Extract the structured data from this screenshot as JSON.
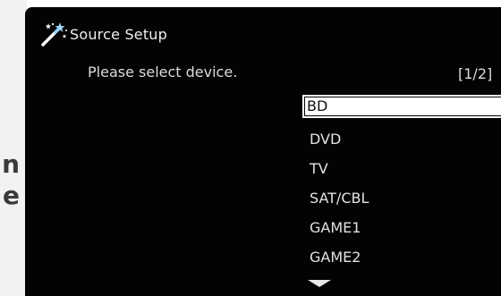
{
  "side_text": [
    "n",
    "e"
  ],
  "header": {
    "icon": "magic-wand-icon",
    "title": "Source Setup"
  },
  "prompt": "Please select device.",
  "page_indicator": "[1/2]",
  "devices": [
    {
      "label": "BD",
      "selected": true
    },
    {
      "label": "DVD",
      "selected": false
    },
    {
      "label": "TV",
      "selected": false
    },
    {
      "label": "SAT/CBL",
      "selected": false
    },
    {
      "label": "GAME1",
      "selected": false
    },
    {
      "label": "GAME2",
      "selected": false
    }
  ],
  "scroll_icon": "arrow-down-icon"
}
